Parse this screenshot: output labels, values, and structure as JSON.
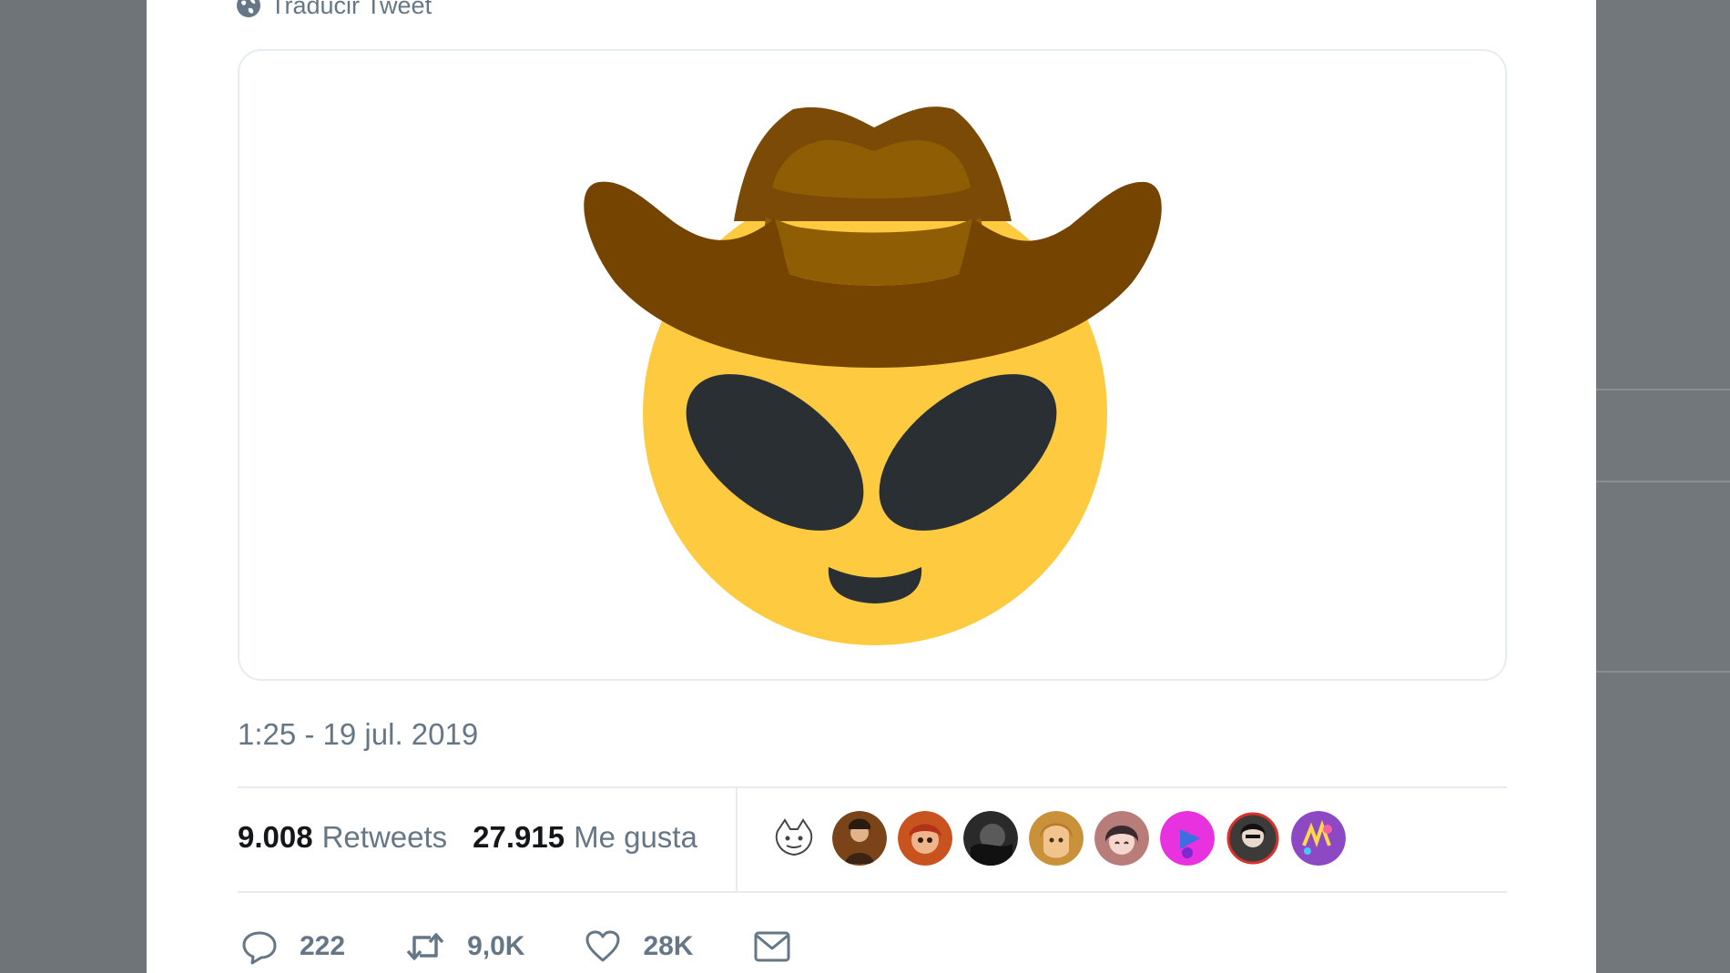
{
  "tweet": {
    "translate_label": "Traducir Tweet",
    "timestamp": "1:25 - 19 jul. 2019",
    "stats": {
      "retweets_count": "9.008",
      "retweets_label": "Retweets",
      "likes_count": "27.915",
      "likes_label": "Me gusta"
    },
    "actions": {
      "reply_count": "222",
      "retweet_count": "9,0K",
      "like_count": "28K"
    },
    "icons": {
      "translate": "globe-icon",
      "reply": "reply-icon",
      "retweet": "retweet-icon",
      "like": "heart-icon",
      "message": "envelope-icon"
    },
    "media": {
      "description": "cowboy alien emoji",
      "colors": {
        "hat": "#7a4a06",
        "hat_light": "#8e5d04",
        "face": "#fecb40",
        "eyes": "#292f33"
      }
    },
    "likers": [
      {
        "name": "avatar-1",
        "color": "#e6e6e6"
      },
      {
        "name": "avatar-2",
        "color": "#7a4418"
      },
      {
        "name": "avatar-3",
        "color": "#c8531f"
      },
      {
        "name": "avatar-4",
        "color": "#2a2a2a"
      },
      {
        "name": "avatar-5",
        "color": "#c9913a"
      },
      {
        "name": "avatar-6",
        "color": "#b87c79"
      },
      {
        "name": "avatar-7",
        "color": "#e832e0"
      },
      {
        "name": "avatar-8",
        "color": "#3d3a3a"
      },
      {
        "name": "avatar-9",
        "color": "#8d49c4"
      }
    ]
  },
  "colors": {
    "page_bg": "#6f7479",
    "card_bg": "#ffffff",
    "text_secondary": "#657786",
    "text_primary": "#14171a",
    "border": "#e6ecf0"
  }
}
